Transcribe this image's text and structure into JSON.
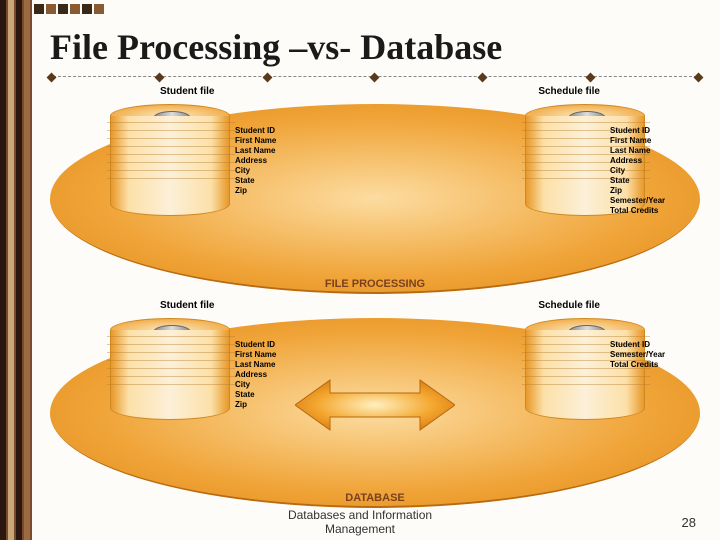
{
  "title": "File Processing –vs- Database",
  "footer": "Databases and Information\nManagement",
  "page_number": "28",
  "file_processing": {
    "section_label": "FILE PROCESSING",
    "student_file": {
      "label": "Student file",
      "fields": [
        "Student ID",
        "First Name",
        "Last Name",
        "Address",
        "City",
        "State",
        "Zip"
      ]
    },
    "schedule_file": {
      "label": "Schedule file",
      "fields": [
        "Student ID",
        "First Name",
        "Last Name",
        "Address",
        "City",
        "State",
        "Zip",
        "Semester/Year",
        "Total Credits"
      ]
    }
  },
  "database": {
    "section_label": "DATABASE",
    "student_file": {
      "label": "Student file",
      "fields": [
        "Student ID",
        "First Name",
        "Last Name",
        "Address",
        "City",
        "State",
        "Zip"
      ]
    },
    "schedule_file": {
      "label": "Schedule file",
      "fields": [
        "Student ID",
        "Semester/Year",
        "Total Credits"
      ]
    }
  }
}
